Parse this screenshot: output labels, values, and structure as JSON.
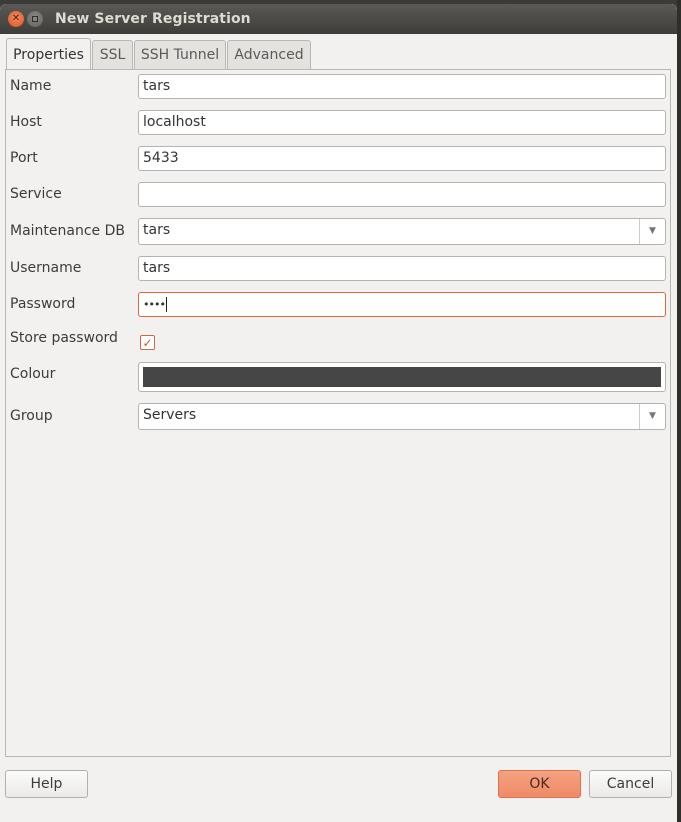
{
  "window": {
    "title": "New Server Registration"
  },
  "tabs": [
    {
      "label": "Properties",
      "active": true
    },
    {
      "label": "SSL",
      "active": false
    },
    {
      "label": "SSH Tunnel",
      "active": false
    },
    {
      "label": "Advanced",
      "active": false
    }
  ],
  "form": {
    "name": {
      "label": "Name",
      "value": "tars"
    },
    "host": {
      "label": "Host",
      "value": "localhost"
    },
    "port": {
      "label": "Port",
      "value": "5433"
    },
    "service": {
      "label": "Service",
      "value": ""
    },
    "maintenance_db": {
      "label": "Maintenance DB",
      "value": "tars"
    },
    "username": {
      "label": "Username",
      "value": "tars"
    },
    "password": {
      "label": "Password",
      "value": "••••"
    },
    "store_password": {
      "label": "Store password",
      "checked": true
    },
    "colour": {
      "label": "Colour",
      "value": "#464646"
    },
    "group": {
      "label": "Group",
      "value": "Servers"
    }
  },
  "buttons": {
    "help": "Help",
    "ok": "OK",
    "cancel": "Cancel"
  },
  "icons": {
    "close": "close-icon",
    "minimize": "minimize-icon",
    "dropdown": "chevron-down-icon",
    "check": "check-icon"
  }
}
